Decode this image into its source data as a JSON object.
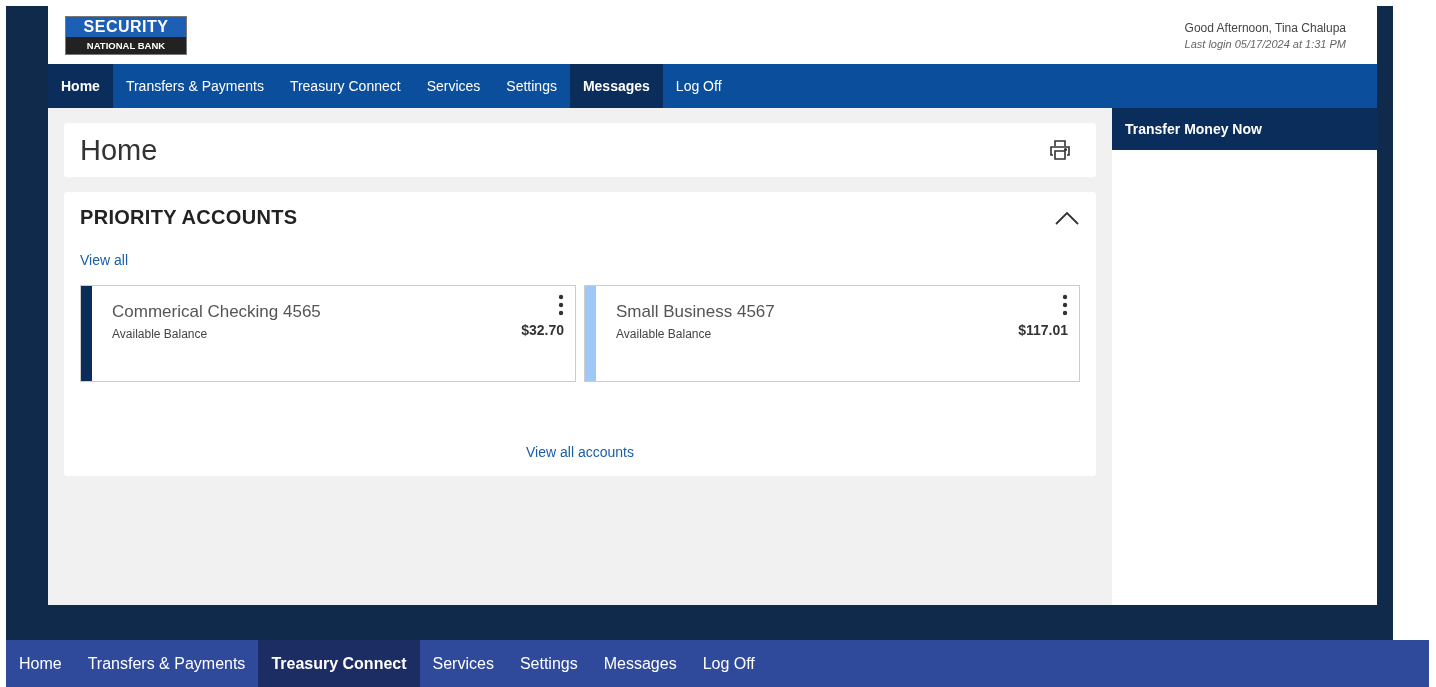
{
  "logo": {
    "line_1": "SECURITY",
    "line_2": "NATIONAL BANK"
  },
  "greeting": {
    "text": "Good Afternoon, Tina Chalupa",
    "last_login": "Last login 05/17/2024 at 1:31 PM"
  },
  "nav": [
    {
      "label": "Home",
      "selected": true
    },
    {
      "label": "Transfers & Payments",
      "selected": false
    },
    {
      "label": "Treasury Connect",
      "selected": false
    },
    {
      "label": "Services",
      "selected": false
    },
    {
      "label": "Settings",
      "selected": false
    },
    {
      "label": "Messages",
      "selected": true
    },
    {
      "label": "Log Off",
      "selected": false
    }
  ],
  "page_title": "Home",
  "priority_accounts": {
    "title": "PRIORITY ACCOUNTS",
    "expanded": true,
    "view_all": "View all",
    "view_all_accounts": "View all accounts",
    "accounts": [
      {
        "name": "Commerical Checking 4565",
        "balance_label": "Available Balance",
        "balance": "$32.70",
        "color": "#0b2d5b"
      },
      {
        "name": "Small Business 4567",
        "balance_label": "Available Balance",
        "balance": "$117.01",
        "color": "#9ec8f5"
      }
    ]
  },
  "side_panel": {
    "title": "Transfer Money Now"
  },
  "bottom_nav": [
    {
      "label": "Home",
      "selected": false
    },
    {
      "label": "Transfers & Payments",
      "selected": false
    },
    {
      "label": "Treasury Connect",
      "selected": true
    },
    {
      "label": "Services",
      "selected": false
    },
    {
      "label": "Settings",
      "selected": false
    },
    {
      "label": "Messages",
      "selected": false
    },
    {
      "label": "Log Off",
      "selected": false
    }
  ]
}
